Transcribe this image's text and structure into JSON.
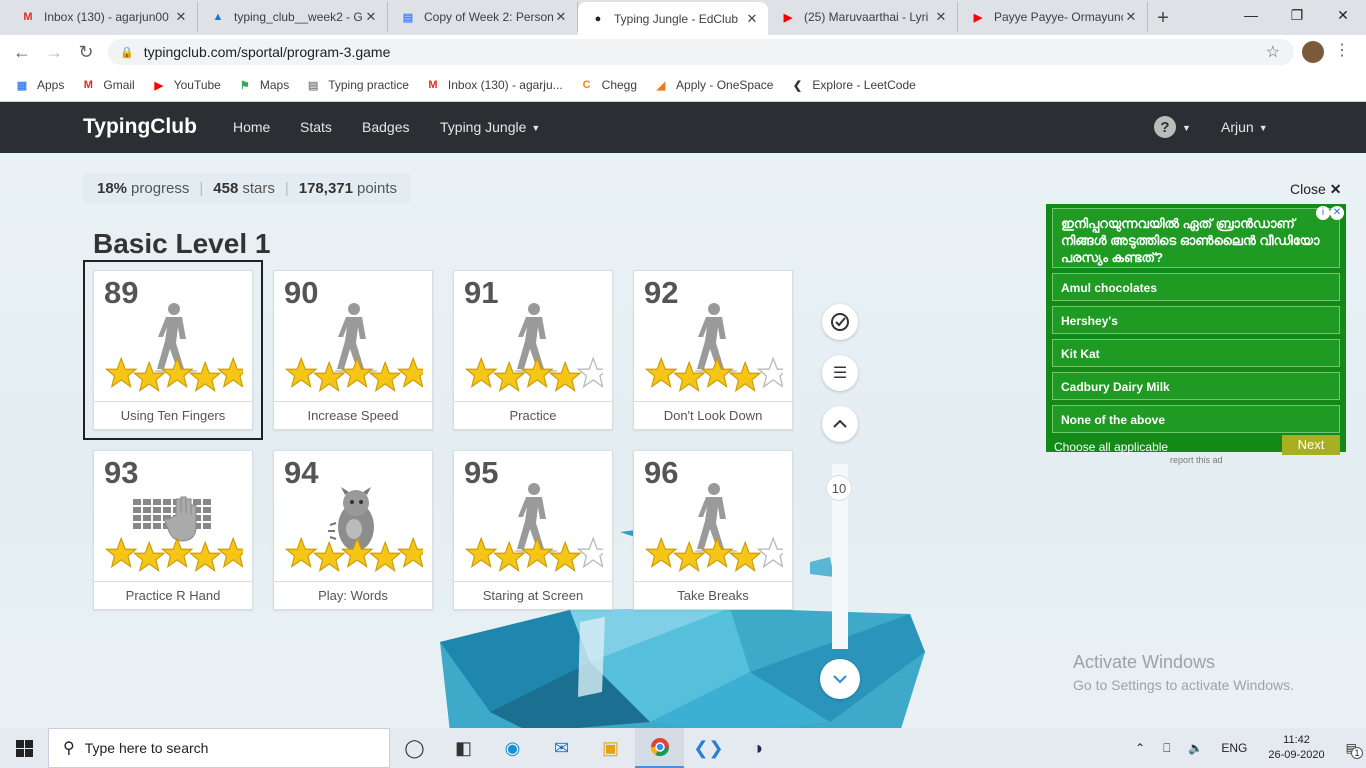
{
  "browser": {
    "tabs": [
      {
        "title": "Inbox (130) - agarjun00",
        "icon": "gmail-icon",
        "color": "#d93025"
      },
      {
        "title": "typing_club__week2 - G",
        "icon": "google-drive-icon",
        "color": "#1a73e8"
      },
      {
        "title": "Copy of Week 2: Person",
        "icon": "google-docs-icon",
        "color": "#4285f4"
      },
      {
        "title": "Typing Jungle - EdClub",
        "icon": "edclub-icon",
        "color": "#222222",
        "active": true
      },
      {
        "title": "(25) Maruvaarthai - Lyri",
        "icon": "youtube-icon",
        "color": "#ff0000"
      },
      {
        "title": "Payye Payye- Ormayunc",
        "icon": "youtube-icon",
        "color": "#ff0000"
      }
    ],
    "new_tab": "+",
    "url": "typingclub.com/sportal/program-3.game",
    "bookmarks": [
      {
        "label": "Apps",
        "icon": "apps-grid-icon"
      },
      {
        "label": "Gmail",
        "icon": "gmail-icon"
      },
      {
        "label": "YouTube",
        "icon": "youtube-icon"
      },
      {
        "label": "Maps",
        "icon": "maps-icon"
      },
      {
        "label": "Typing practice",
        "icon": "page-icon"
      },
      {
        "label": "Inbox (130) - agarju...",
        "icon": "gmail-icon"
      },
      {
        "label": "Chegg",
        "icon": "chegg-icon"
      },
      {
        "label": "Apply - OneSpace",
        "icon": "onespace-icon"
      },
      {
        "label": "Explore - LeetCode",
        "icon": "leetcode-icon"
      }
    ]
  },
  "nav": {
    "logo": "TypingClub",
    "links": [
      "Home",
      "Stats",
      "Badges",
      "Typing Jungle"
    ],
    "help": "?",
    "user": "Arjun"
  },
  "stats": {
    "progress_value": "18%",
    "progress_label": "progress",
    "stars_value": "458",
    "stars_label": "stars",
    "points_value": "178,371",
    "points_label": "points"
  },
  "level_title": "Basic Level 1",
  "lessons": [
    {
      "number": "89",
      "label": "Using Ten Fingers",
      "stars": 5,
      "figure": "walker",
      "selected": true
    },
    {
      "number": "90",
      "label": "Increase Speed",
      "stars": 5,
      "figure": "walker"
    },
    {
      "number": "91",
      "label": "Practice",
      "stars": 4,
      "figure": "walker"
    },
    {
      "number": "92",
      "label": "Don't Look Down",
      "stars": 4,
      "figure": "walker"
    },
    {
      "number": "93",
      "label": "Practice R Hand",
      "stars": 5,
      "figure": "keyboard-hand"
    },
    {
      "number": "94",
      "label": "Play: Words",
      "stars": 5,
      "figure": "monster"
    },
    {
      "number": "95",
      "label": "Staring at Screen",
      "stars": 4,
      "figure": "walker"
    },
    {
      "number": "96",
      "label": "Take Breaks",
      "stars": 4,
      "figure": "walker"
    }
  ],
  "side": {
    "page_number": "10"
  },
  "ad": {
    "close_label": "Close",
    "question": "ഇനിപ്പറയുന്നവയിൽ ഏത് ബ്രാൻഡാണ് നിങ്ങൾ അടുത്തിടെ ഓൺലൈൻ വീഡിയോ പരസ്യം കണ്ടത്?",
    "options": [
      "Amul chocolates",
      "Hershey's",
      "Kit Kat",
      "Cadbury Dairy Milk",
      "None of the above"
    ],
    "choose": "Choose all applicable",
    "next": "Next",
    "report": "report this ad"
  },
  "watermark": {
    "line1": "Activate Windows",
    "line2": "Go to Settings to activate Windows."
  },
  "taskbar": {
    "search_placeholder": "Type here to search",
    "lang": "ENG",
    "time": "11:42",
    "date": "26-09-2020",
    "notifications": "1"
  },
  "colors": {
    "accent": "#2b2f33",
    "star": "#f5c518",
    "ad_green": "#138a18"
  }
}
